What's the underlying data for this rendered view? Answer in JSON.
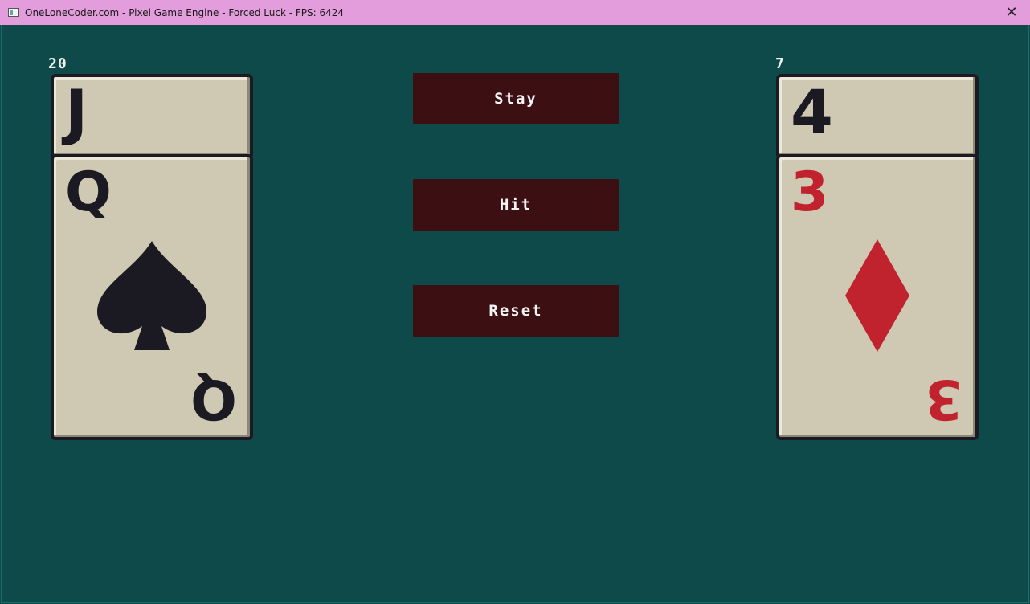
{
  "window": {
    "title": "OneLoneCoder.com - Pixel Game Engine - Forced Luck - FPS: 6424",
    "close_glyph": "✕"
  },
  "player": {
    "score": "20",
    "cards": [
      {
        "rank": "J",
        "suit": "spade-icon",
        "color": "#1b1a22"
      },
      {
        "rank": "Q",
        "suit": "spade-icon",
        "color": "#1b1a22"
      }
    ]
  },
  "dealer": {
    "score": "7",
    "cards": [
      {
        "rank": "4",
        "suit": "club-icon",
        "color": "#1b1a22"
      },
      {
        "rank": "3",
        "suit": "diamond-icon",
        "color": "#c0232e"
      }
    ]
  },
  "buttons": {
    "stay": "Stay",
    "hit": "Hit",
    "reset": "Reset"
  },
  "colors": {
    "table": "#0f4a4b",
    "card_face": "#cfc8b3",
    "card_border": "#1b1a22",
    "button_bg": "#3c0f12",
    "red_suit": "#c0232e",
    "titlebar": "#e49ddc"
  }
}
